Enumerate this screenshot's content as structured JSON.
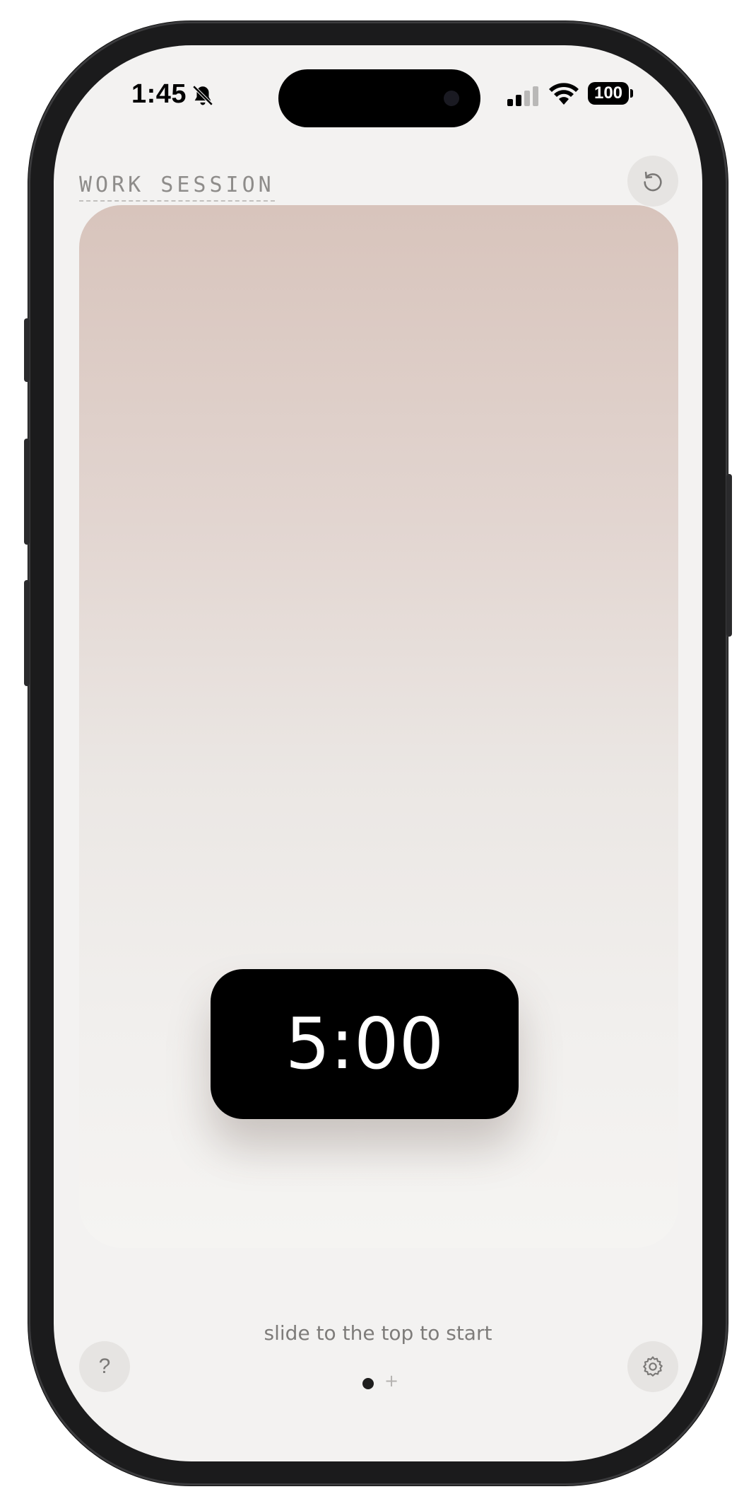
{
  "status_bar": {
    "time": "1:45",
    "battery": "100",
    "icons": [
      "bell-slash-icon",
      "cellular-signal-icon",
      "wifi-icon",
      "battery-icon"
    ]
  },
  "header": {
    "title": "WORK SESSION",
    "reset_icon": "reset-icon"
  },
  "timer": {
    "value": "5:00"
  },
  "hint": "slide to the top to start",
  "footer": {
    "help_label": "?",
    "page_add_label": "+",
    "settings_icon": "gear-icon"
  },
  "colors": {
    "screen_bg": "#f3f2f1",
    "card_top": "#d8c4bc",
    "card_bottom": "#f5f4f2",
    "timer_bg": "#000000",
    "timer_text": "#ffffff"
  }
}
